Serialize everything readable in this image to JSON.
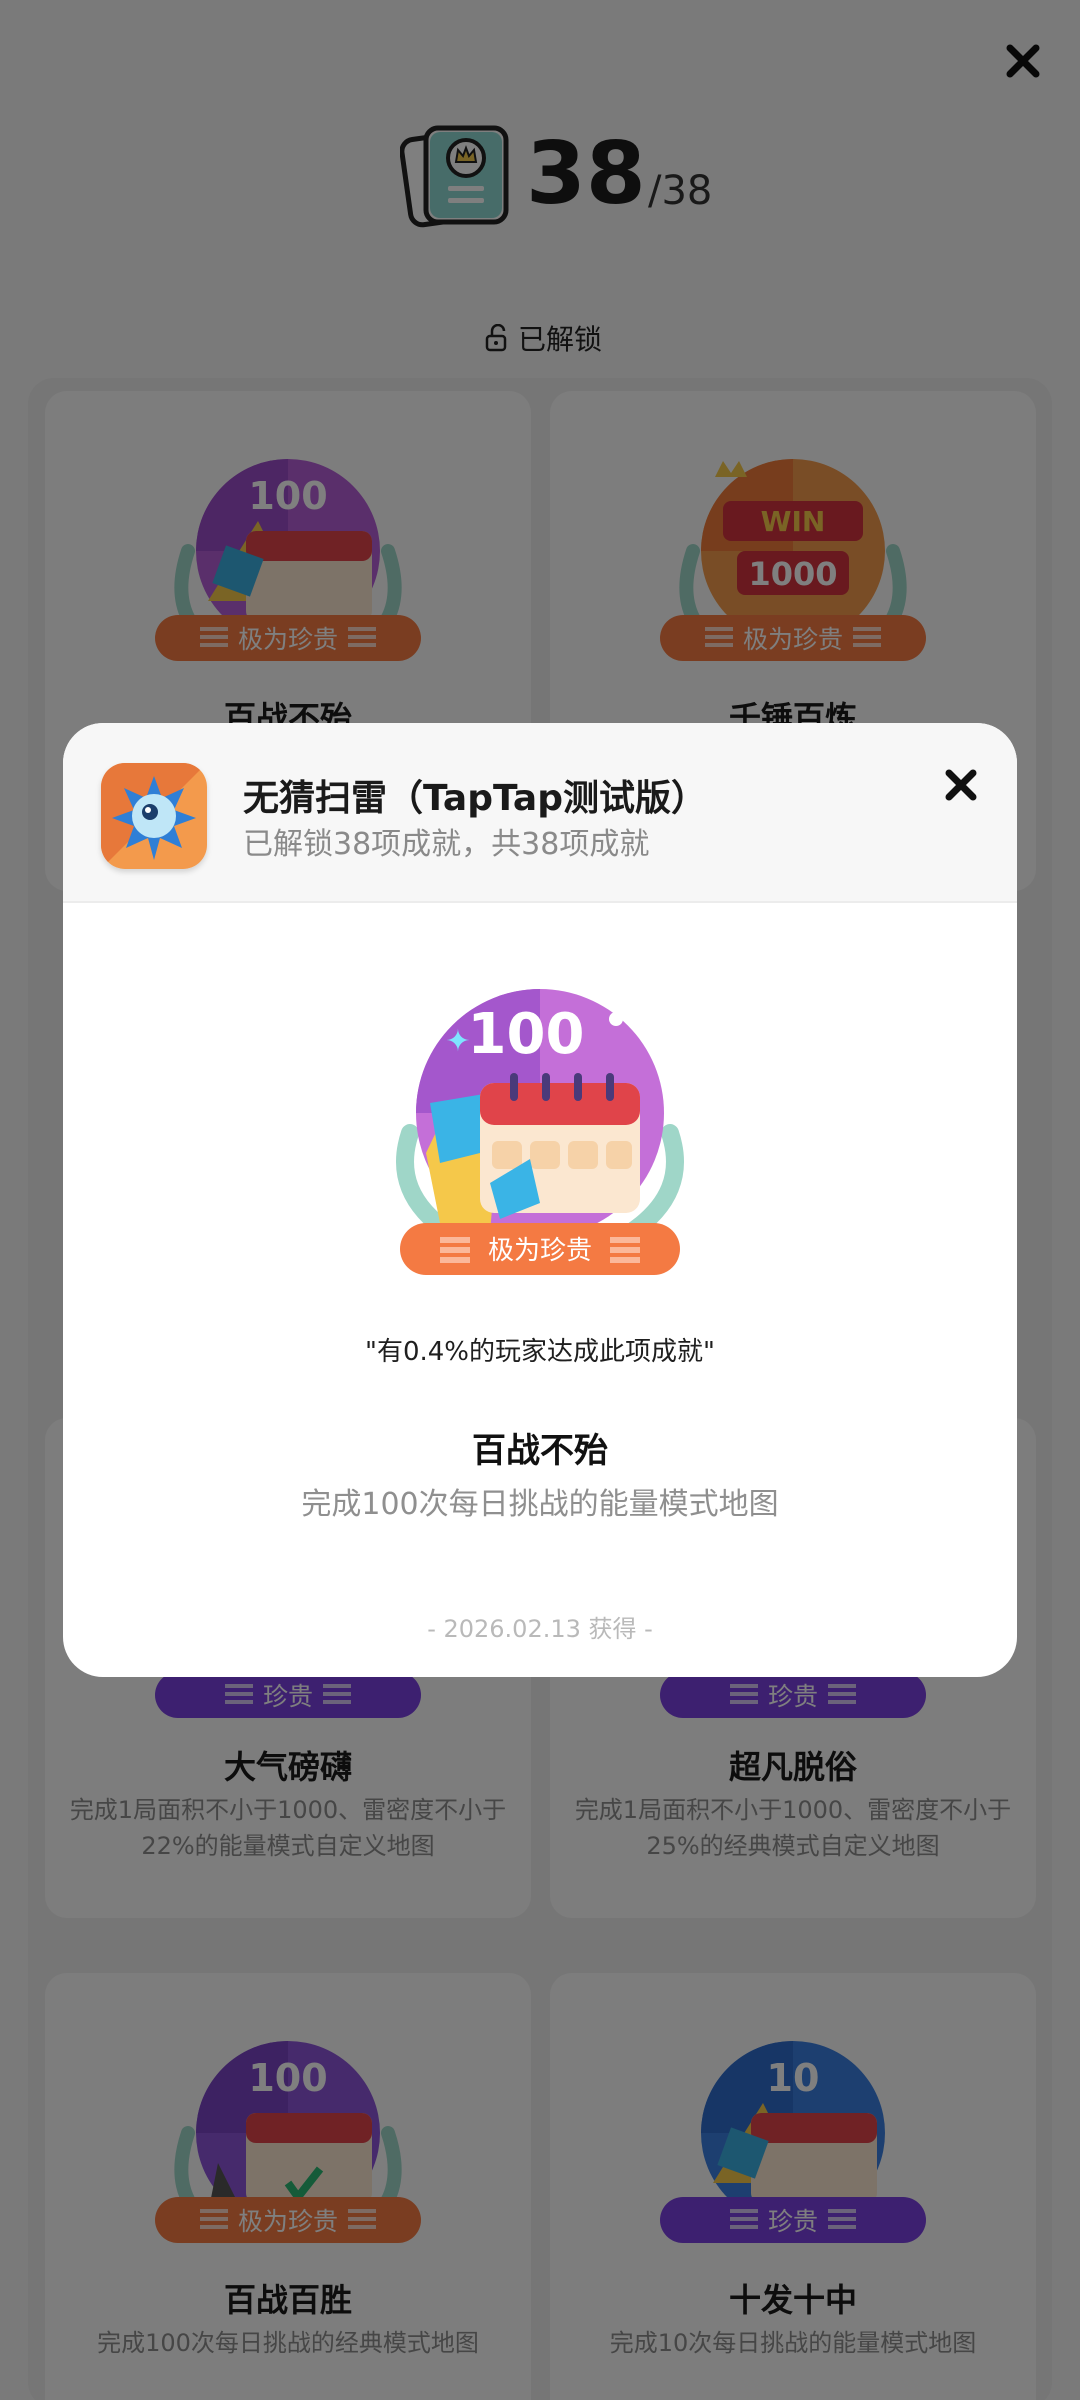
{
  "header": {
    "count": "38",
    "total": "/38",
    "unlock_label": "已解锁"
  },
  "badges": {
    "very_rare": "极为珍贵",
    "rare": "珍贵"
  },
  "achievements": [
    {
      "title": "百战不殆",
      "desc": "",
      "badge": "极为珍贵",
      "medal_number": "100",
      "medal_theme": "purple"
    },
    {
      "title": "千锤百炼",
      "desc": "",
      "badge": "极为珍贵",
      "medal_number": "1000",
      "medal_extra": "WIN",
      "medal_theme": "orange"
    },
    {
      "title": "大气磅礴",
      "desc": "完成1局面积不小于1000、雷密度不小于22%的能量模式自定义地图",
      "badge": "珍贵"
    },
    {
      "title": "超凡脱俗",
      "desc": "完成1局面积不小于1000、雷密度不小于25%的经典模式自定义地图",
      "badge": "珍贵"
    },
    {
      "title": "百战百胜",
      "desc": "完成100次每日挑战的经典模式地图",
      "badge": "极为珍贵",
      "medal_number": "100",
      "medal_theme": "violet"
    },
    {
      "title": "十发十中",
      "desc": "完成10次每日挑战的能量模式地图",
      "badge": "珍贵",
      "medal_number": "10",
      "medal_theme": "blue"
    }
  ],
  "dialog": {
    "app_name": "无猜扫雷（TapTap测试版）",
    "progress": "已解锁38项成就，共38项成就",
    "medal_number": "100",
    "badge": "极为珍贵",
    "quote": "\"有0.4%的玩家达成此项成就\"",
    "title": "百战不殆",
    "desc": "完成100次每日挑战的能量模式地图",
    "date": "- 2026.02.13 获得 -"
  },
  "colors": {
    "badge_orange": "#f47a43",
    "badge_purple": "#7a40e0",
    "scrim": "rgba(0,0,0,0.5)"
  }
}
